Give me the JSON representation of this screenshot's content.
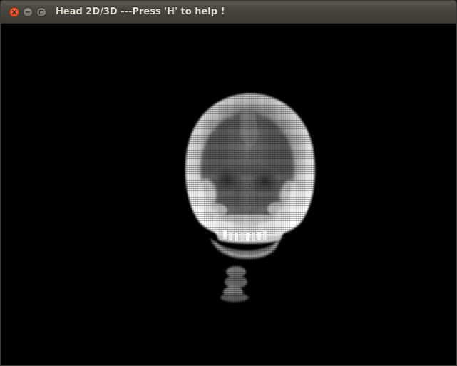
{
  "window": {
    "title": "Head 2D/3D ---Press 'H' to help !",
    "buttons": {
      "close": "close-icon",
      "minimize": "minimize-icon",
      "maximize": "maximize-icon"
    }
  },
  "render": {
    "background": "#000000",
    "subject": "volume-rendered-skull"
  }
}
